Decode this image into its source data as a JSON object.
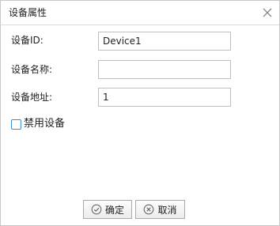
{
  "dialog": {
    "title": "设备属性"
  },
  "form": {
    "device_id": {
      "label": "设备ID:",
      "value": "Device1"
    },
    "device_name": {
      "label": "设备名称:",
      "value": ""
    },
    "device_address": {
      "label": "设备地址:",
      "value": "1"
    },
    "disable_device": {
      "label": "禁用设备",
      "checked": false
    }
  },
  "buttons": {
    "ok_label": "确定",
    "cancel_label": "取消"
  },
  "icons": {
    "close": "close-icon",
    "ok": "check-circle-icon",
    "cancel": "x-circle-icon"
  },
  "colors": {
    "checkbox_border": "#3b8ed1",
    "button_border": "#a9a9a9",
    "dialog_border": "#c8c8c8"
  }
}
